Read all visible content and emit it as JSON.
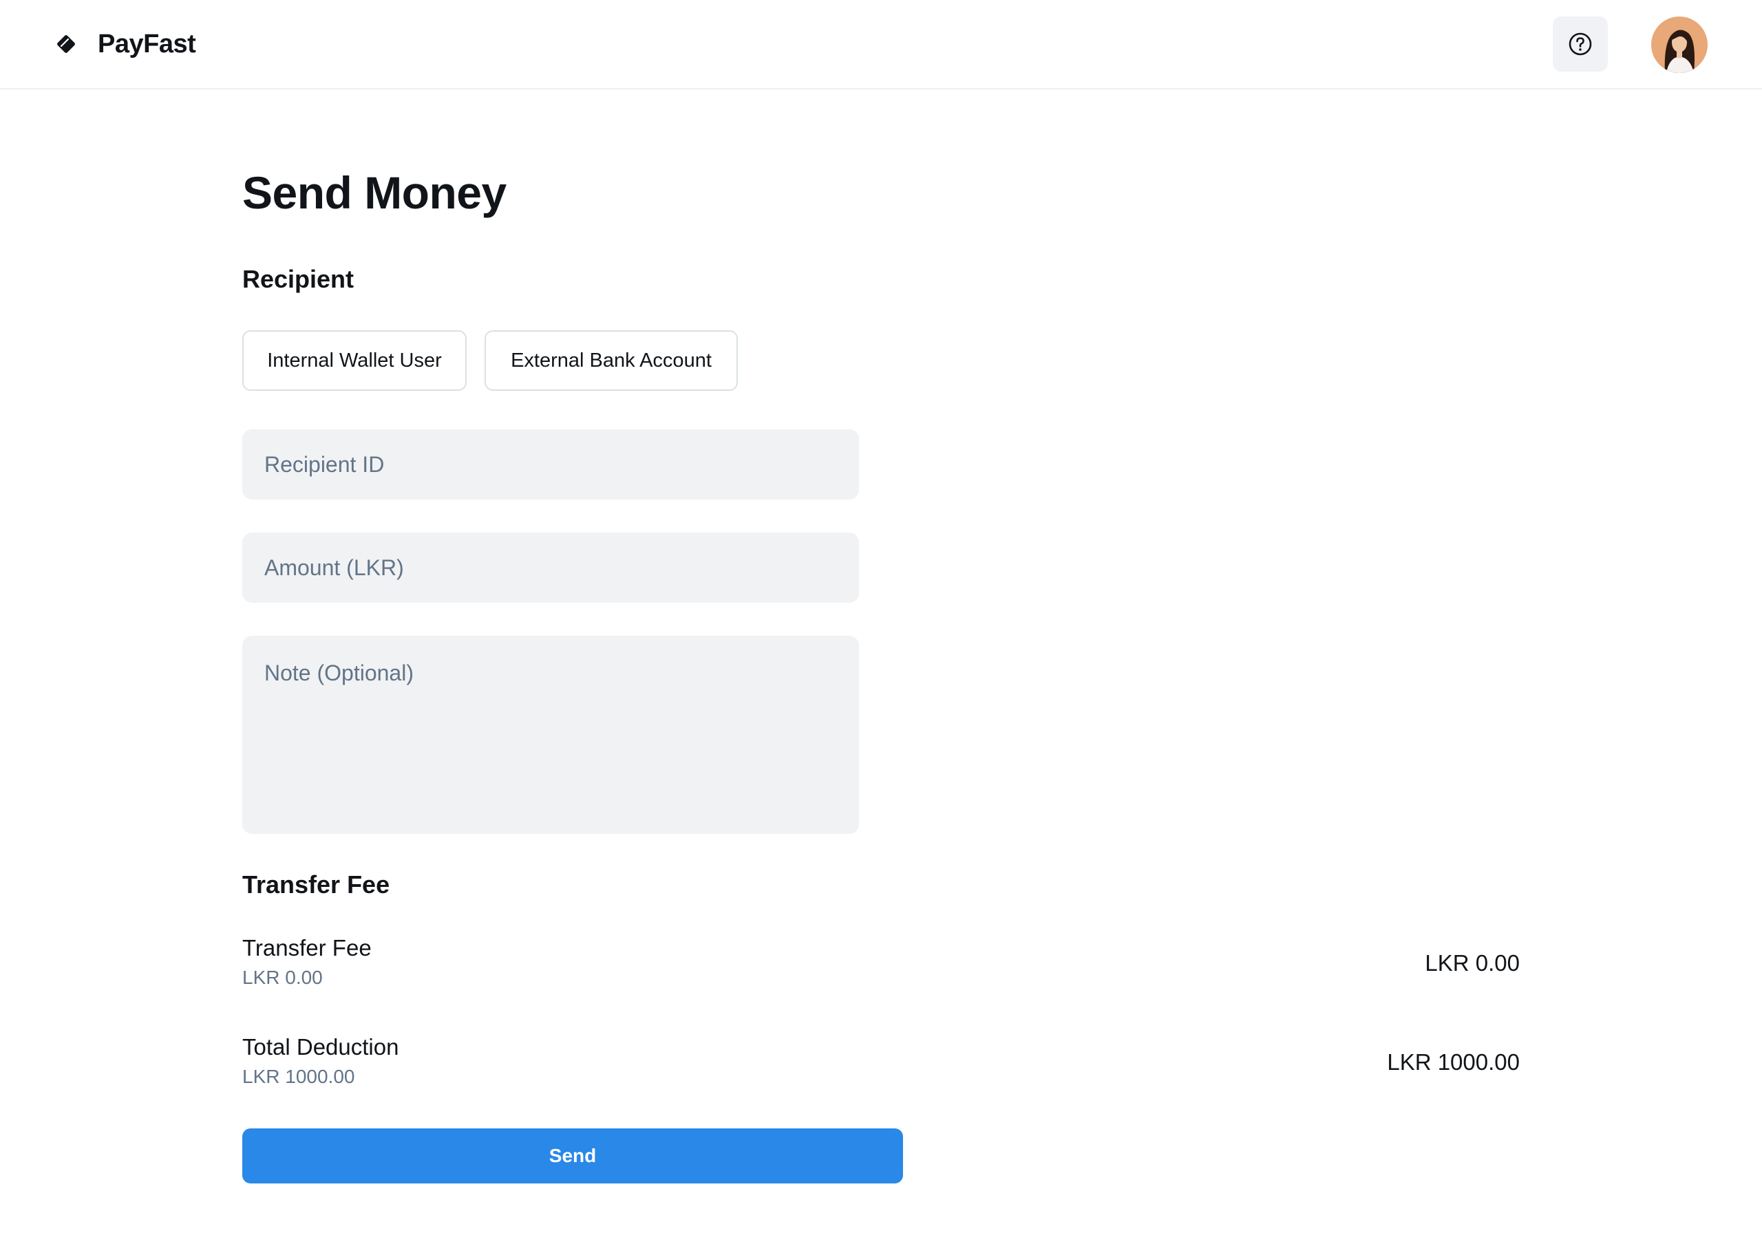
{
  "header": {
    "brand_name": "PayFast",
    "logo_icon": "wallet-tag-icon",
    "help_icon": "question-circle-icon"
  },
  "page": {
    "title": "Send Money"
  },
  "recipient": {
    "section_title": "Recipient",
    "options": [
      "Internal Wallet User",
      "External Bank Account"
    ]
  },
  "form": {
    "recipient_id_placeholder": "Recipient ID",
    "recipient_id_value": "",
    "amount_placeholder": "Amount (LKR)",
    "amount_value": "",
    "note_placeholder": "Note (Optional)",
    "note_value": ""
  },
  "fees": {
    "section_title": "Transfer Fee",
    "rows": [
      {
        "label": "Transfer Fee",
        "sub": "LKR 0.00",
        "amount": "LKR 0.00"
      },
      {
        "label": "Total Deduction",
        "sub": "LKR 1000.00",
        "amount": "LKR 1000.00"
      }
    ]
  },
  "actions": {
    "send_label": "Send"
  },
  "colors": {
    "primary": "#2a88e8",
    "input_bg": "#f0f2f4",
    "muted_text": "#637488"
  }
}
